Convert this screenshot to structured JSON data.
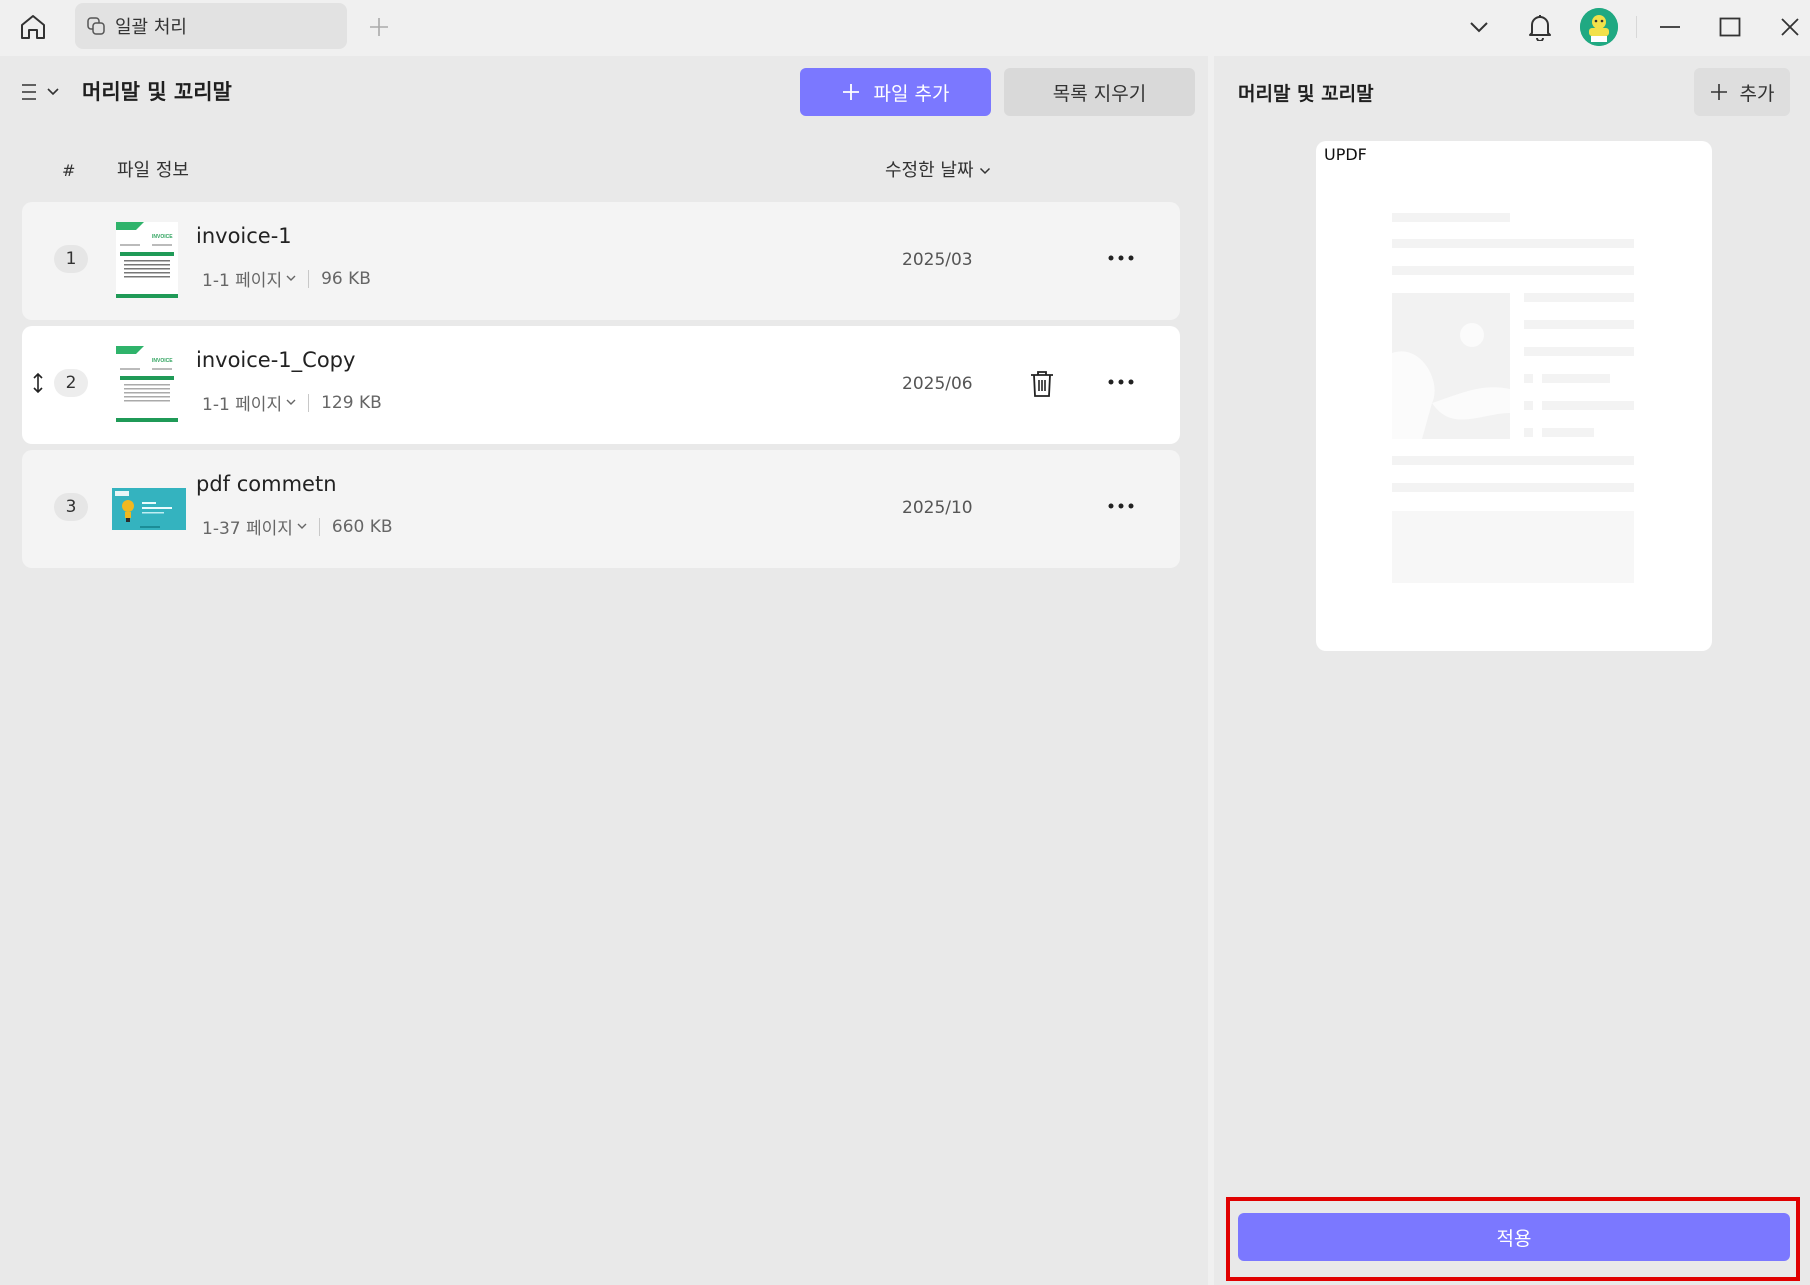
{
  "titlebar": {
    "tab_label": "일괄 처리"
  },
  "left": {
    "title": "머리말 및 꼬리말",
    "add_file_label": "파일 추가",
    "clear_list_label": "목록 지우기",
    "columns": {
      "num": "#",
      "info": "파일 정보",
      "date": "수정한 날짜"
    },
    "files": [
      {
        "num": "1",
        "name": "invoice-1",
        "pages": "1-1 페이지",
        "size": "96 KB",
        "date": "2025/03"
      },
      {
        "num": "2",
        "name": "invoice-1_Copy",
        "pages": "1-1 페이지",
        "size": "129 KB",
        "date": "2025/06"
      },
      {
        "num": "3",
        "name": "pdf commetn",
        "pages": "1-37 페이지",
        "size": "660 KB",
        "date": "2025/10"
      }
    ]
  },
  "right": {
    "title": "머리말 및 꼬리말",
    "add_label": "추가",
    "preview_label": "UPDF",
    "apply_label": "적용"
  },
  "colors": {
    "accent": "#7b78ff",
    "highlight_frame": "#e00000"
  }
}
